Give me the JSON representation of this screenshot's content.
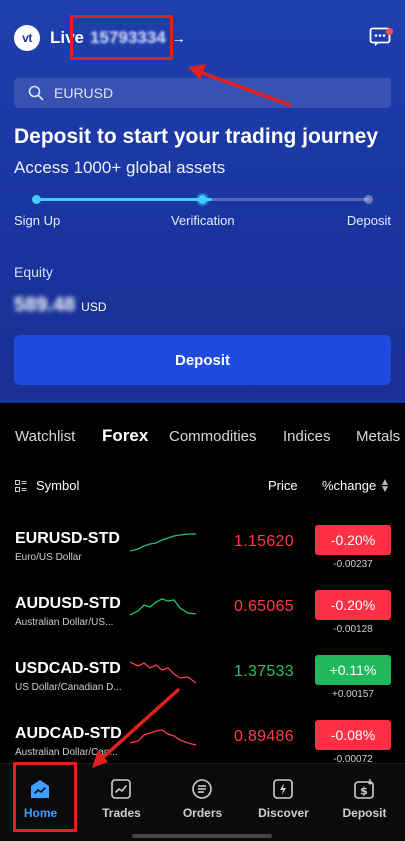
{
  "header": {
    "logo_text": "vt",
    "account_type": "Live",
    "account_number": "15793334",
    "account_arrow": "→"
  },
  "search": {
    "placeholder": "EURUSD"
  },
  "onboarding": {
    "headline": "Deposit to start your trading journey",
    "subline": "Access 1000+ global assets",
    "progress_fraction": 0.53,
    "steps": [
      {
        "label": "Sign Up",
        "state": "done"
      },
      {
        "label": "Verification",
        "state": "current"
      },
      {
        "label": "Deposit",
        "state": "todo"
      }
    ]
  },
  "equity": {
    "label": "Equity",
    "value": "589.48",
    "currency": "USD"
  },
  "deposit_button": {
    "label": "Deposit"
  },
  "market_tabs": [
    {
      "label": "Watchlist",
      "active": false
    },
    {
      "label": "Forex",
      "active": true
    },
    {
      "label": "Commodities",
      "active": false
    },
    {
      "label": "Indices",
      "active": false
    },
    {
      "label": "Metals",
      "active": false
    }
  ],
  "columns": {
    "symbol": "Symbol",
    "price": "Price",
    "change": "%change"
  },
  "quotes": [
    {
      "symbol": "EURUSD-STD",
      "description": "Euro/US Dollar",
      "price": "1.15620",
      "change_pct": "-0.20%",
      "change_abs": "-0.00237",
      "direction": "down",
      "trend": "up"
    },
    {
      "symbol": "AUDUSD-STD",
      "description": "Australian Dollar/US...",
      "price": "0.65065",
      "change_pct": "-0.20%",
      "change_abs": "-0.00128",
      "direction": "down",
      "trend": "up"
    },
    {
      "symbol": "USDCAD-STD",
      "description": "US Dollar/Canadian D...",
      "price": "1.37533",
      "change_pct": "+0.11%",
      "change_abs": "+0.00157",
      "direction": "up",
      "trend": "down"
    },
    {
      "symbol": "AUDCAD-STD",
      "description": "Australian Dollar/Can...",
      "price": "0.89486",
      "change_pct": "-0.08%",
      "change_abs": "-0.00072",
      "direction": "down",
      "trend": "down"
    }
  ],
  "bottom_nav": [
    {
      "label": "Home",
      "icon": "home-chart-icon",
      "active": true
    },
    {
      "label": "Trades",
      "icon": "trades-chart-icon",
      "active": false
    },
    {
      "label": "Orders",
      "icon": "orders-list-icon",
      "active": false
    },
    {
      "label": "Discover",
      "icon": "discover-bolt-icon",
      "active": false
    },
    {
      "label": "Deposit",
      "icon": "deposit-dollar-icon",
      "active": false
    }
  ],
  "colors": {
    "hero_top": "#1f3fae",
    "hero_bottom": "#1a2f93",
    "accent_blue": "#1f4be0",
    "progress": "#3fd0ff",
    "down_red": "#ff3b4a",
    "down_badge": "#ff2f45",
    "up_green": "#27c16a",
    "up_badge": "#1fb85a",
    "nav_active": "#3fa0ff",
    "annotation": "#e32020"
  }
}
